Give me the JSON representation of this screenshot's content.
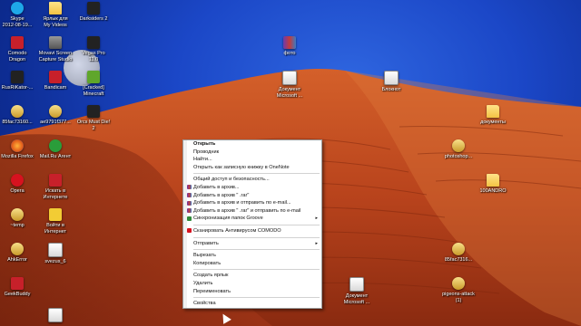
{
  "desktop": {
    "icons": [
      {
        "label": "Skype\n2012-08-19...",
        "type": "skype"
      },
      {
        "label": "Ярлык для\nMy Videos",
        "type": "folder"
      },
      {
        "label": "Darksiders 2",
        "type": "dark"
      },
      {
        "label": "Comodo\nDragon",
        "type": "red"
      },
      {
        "label": "Movavi Screen\nCapture Studio",
        "type": "gray"
      },
      {
        "label": "Vegas Pro\n11.0",
        "type": "dark"
      },
      {
        "label": "RusRiKator-...",
        "type": "dark"
      },
      {
        "label": "Bandicam",
        "type": "red"
      },
      {
        "label": "[Cracked]\nMinecraft",
        "type": "green"
      },
      {
        "label": "85fac73160...",
        "type": "avi"
      },
      {
        "label": "ae9791f377...",
        "type": "avi"
      },
      {
        "label": "Orcs Must Die!\n2",
        "type": "dark"
      },
      {
        "label": "Mozilla Firefox",
        "type": "firefox"
      },
      {
        "label": "Mail.Ru Агент",
        "type": "mail"
      },
      {
        "label": "Opera",
        "type": "opera"
      },
      {
        "label": "Искать в\nИнтернете",
        "type": "red"
      },
      {
        "label": "~temp",
        "type": "avi"
      },
      {
        "label": "Войти в\nИнтернет",
        "type": "yellow"
      },
      {
        "label": "AhkError",
        "type": "avi"
      },
      {
        "label": "svezus_6",
        "type": "doc"
      },
      {
        "label": "GeekBuddy",
        "type": "red"
      },
      {
        "label": "",
        "type": "doc"
      },
      {
        "label": "фото",
        "type": "winrar"
      },
      {
        "label": "Документ\nMicrosoft ...",
        "type": "doc"
      },
      {
        "label": "Блокнот",
        "type": "doc"
      },
      {
        "label": "документы",
        "type": "folder"
      },
      {
        "label": "photoshop...",
        "type": "avi"
      },
      {
        "label": "100ANDRO",
        "type": "folder"
      },
      {
        "label": "85fac7316...",
        "type": "avi"
      },
      {
        "label": "Документ\nMicrosoft ...",
        "type": "doc"
      },
      {
        "label": "pigeons-attack\n(1)",
        "type": "avi"
      }
    ]
  },
  "context_menu": {
    "items": [
      {
        "label": "Открыть",
        "bold": true
      },
      {
        "label": "Проводник"
      },
      {
        "label": "Найти..."
      },
      {
        "label": "Открыть как записную книжку в OneNote"
      },
      {
        "separator": true
      },
      {
        "label": "Общий доступ и безопасность..."
      },
      {
        "label": "Добавить в архив...",
        "icon": "winrar"
      },
      {
        "label": "Добавить в архив \" .rar\"",
        "icon": "winrar"
      },
      {
        "label": "Добавить в архив и отправить по e-mail...",
        "icon": "winrar"
      },
      {
        "label": "Добавить в архив \" .rar\" и отправить по e-mail",
        "icon": "winrar"
      },
      {
        "label": "Синхронизация папок Groove",
        "icon": "groove",
        "submenu": true
      },
      {
        "separator": true
      },
      {
        "label": "Сканировать Антивирусом COMODO",
        "icon": "comodo"
      },
      {
        "separator": true
      },
      {
        "label": "Отправить",
        "submenu": true
      },
      {
        "separator": true
      },
      {
        "label": "Вырезать"
      },
      {
        "label": "Копировать"
      },
      {
        "separator": true
      },
      {
        "label": "Создать ярлык"
      },
      {
        "label": "Удалить"
      },
      {
        "label": "Переименовать"
      },
      {
        "separator": true
      },
      {
        "label": "Свойства"
      }
    ],
    "submenu_arrow": "▸"
  },
  "colors": {
    "sky": "#1b47c7",
    "dune": "#c44a1f",
    "menu_bg": "#ffffff"
  }
}
